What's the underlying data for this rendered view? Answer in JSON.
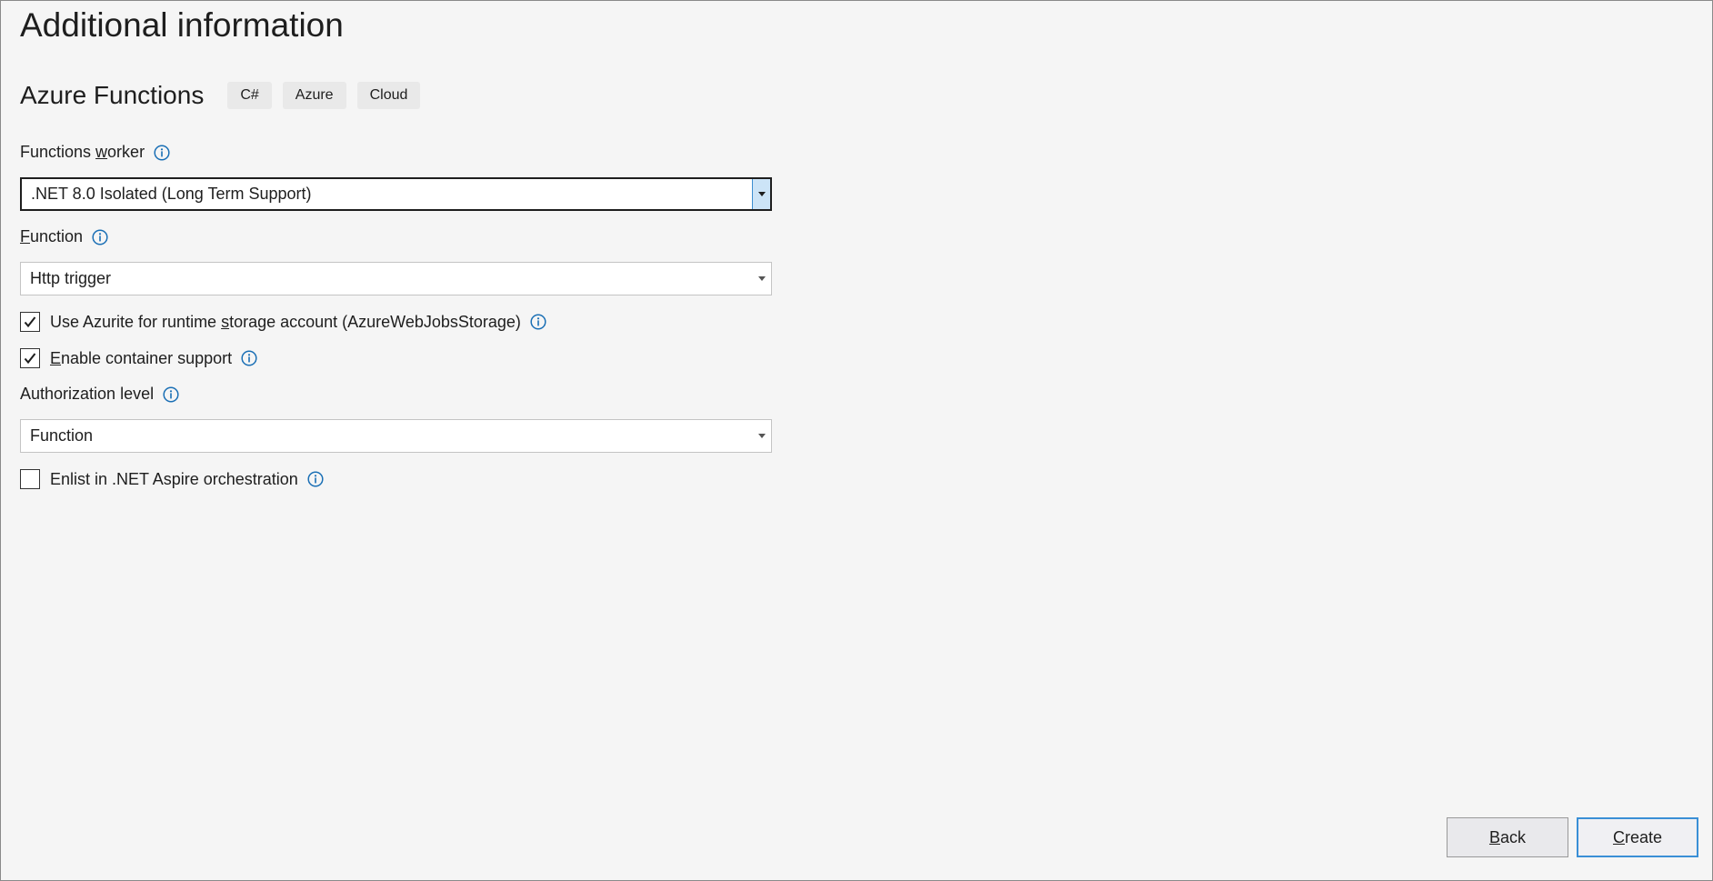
{
  "page": {
    "title": "Additional information"
  },
  "template": {
    "name": "Azure Functions",
    "tags": [
      "C#",
      "Azure",
      "Cloud"
    ]
  },
  "functions_worker": {
    "label_pre": "Functions ",
    "label_key": "w",
    "label_post": "orker",
    "value": ".NET 8.0 Isolated (Long Term Support)"
  },
  "function": {
    "label_key": "F",
    "label_post": "unction",
    "value": "Http trigger"
  },
  "azurite": {
    "checked": true,
    "label_pre": "Use Azurite for runtime ",
    "label_key": "s",
    "label_post": "torage account (AzureWebJobsStorage)"
  },
  "container": {
    "checked": true,
    "label_key": "E",
    "label_post": "nable container support"
  },
  "authorization": {
    "label": "Authorization level",
    "value": "Function"
  },
  "aspire": {
    "checked": false,
    "label": "Enlist in .NET Aspire orchestration"
  },
  "buttons": {
    "back_key": "B",
    "back_post": "ack",
    "create_key": "C",
    "create_post": "reate"
  },
  "colors": {
    "info_icon": "#1a6fb5",
    "focus_border": "#3a8fd6",
    "background": "#f5f5f5"
  },
  "icons": {
    "info": "info-circle-icon",
    "dropdown": "caret-down-icon",
    "check": "checkmark-icon"
  }
}
